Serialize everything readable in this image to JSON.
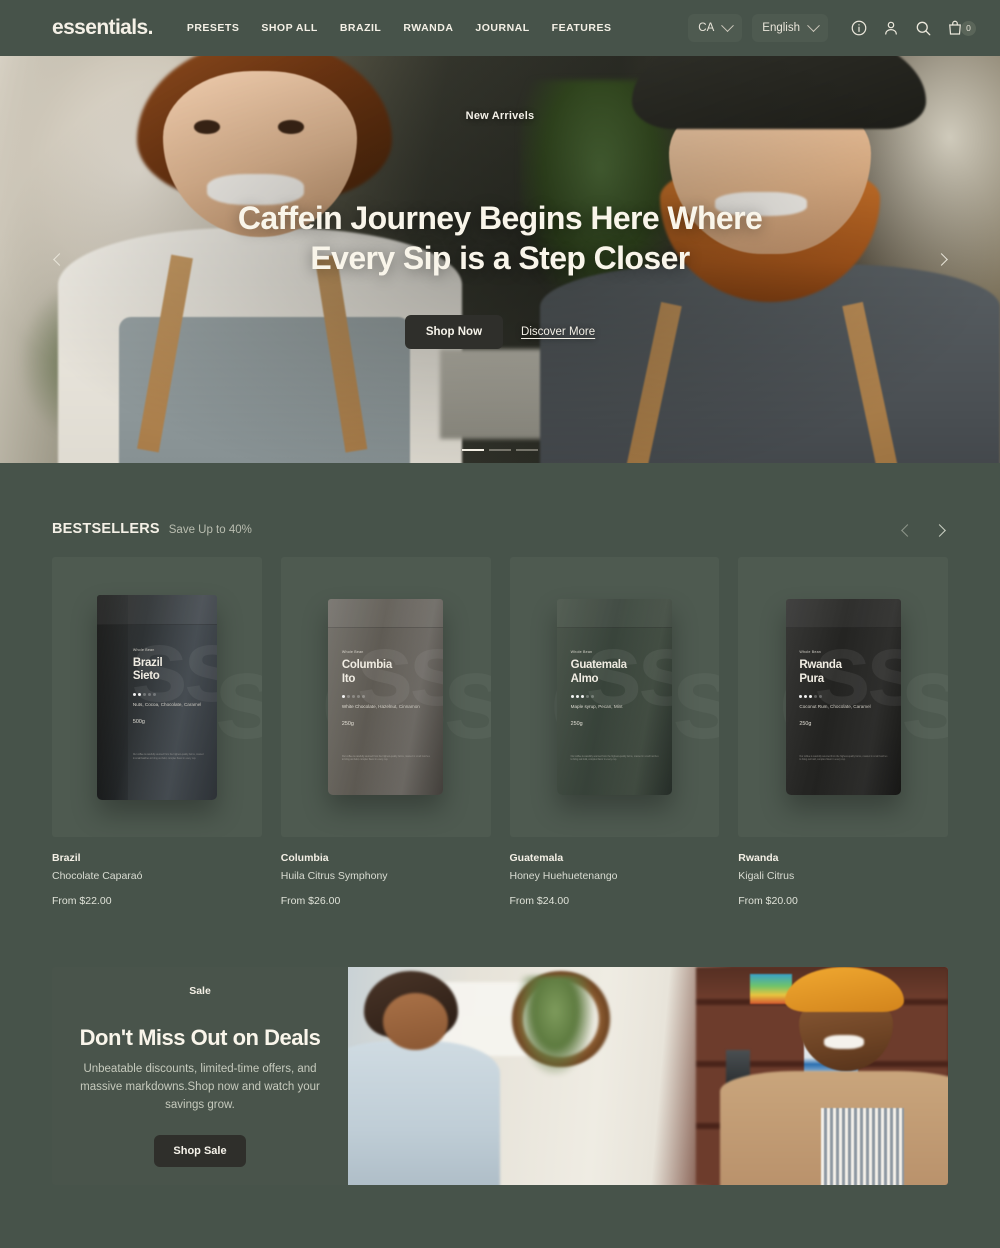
{
  "colors": {
    "page_bg": "#47534a",
    "card_bg": "#4e5a50",
    "cream": "#f4f0e6",
    "dark_button": "#2f2f2b"
  },
  "header": {
    "logo": "essentials.",
    "nav": [
      {
        "label": "PRESETS"
      },
      {
        "label": "SHOP ALL"
      },
      {
        "label": "BRAZIL"
      },
      {
        "label": "RWANDA"
      },
      {
        "label": "JOURNAL"
      },
      {
        "label": "FEATURES"
      }
    ],
    "country_selector": {
      "value": "CA",
      "icon": "chevron-down-icon"
    },
    "language_selector": {
      "value": "English",
      "icon": "chevron-down-icon"
    },
    "icons": [
      {
        "name": "info-icon"
      },
      {
        "name": "account-icon"
      },
      {
        "name": "search-icon"
      }
    ],
    "cart": {
      "name": "cart-icon",
      "count": "0"
    }
  },
  "hero": {
    "eyebrow": "New Arrivels",
    "title": "Caffein Journey Begins Here Where Every Sip is a Step Closer",
    "primary_cta": "Shop Now",
    "secondary_cta": "Discover More",
    "prev_icon": "chevron-left-icon",
    "next_icon": "chevron-right-icon",
    "slides_total": 3,
    "active_slide": 1
  },
  "bestsellers": {
    "title": "BESTSELLERS",
    "subtitle": "Save Up to 40%",
    "prev_icon": "chevron-left-icon",
    "next_icon": "chevron-right-icon",
    "products": [
      {
        "origin": "Brazil",
        "name": "Chocolate Caparaó",
        "price": "From $22.00",
        "bag": {
          "kicker": "Whole Bean",
          "line1": "Brazil",
          "line2": "Sieto",
          "roast_filled": 2,
          "notes": "Nuts, Cocoa, Chocolate, Caramel",
          "weight": "500g",
          "fine_print": "Our coffee is carefully sourced from the highest-quality farms, roasted in small batches to bring out bold, complex flavor in every cup."
        }
      },
      {
        "origin": "Columbia",
        "name": "Huila Citrus Symphony",
        "price": "From $26.00",
        "bag": {
          "kicker": "Whole Bean",
          "line1": "Columbia",
          "line2": "Ito",
          "roast_filled": 1,
          "notes": "White Chocolate, Hazelnut, Cinnamon",
          "weight": "250g",
          "fine_print": "Our coffee is carefully sourced from the highest-quality farms, roasted in small batches to bring out bold, complex flavor in every cup."
        }
      },
      {
        "origin": "Guatemala",
        "name": "Honey Huehuetenango",
        "price": "From $24.00",
        "bag": {
          "kicker": "Whole Bean",
          "line1": "Guatemala",
          "line2": "Almo",
          "roast_filled": 3,
          "notes": "Maple syrup, Pecan, Mint",
          "weight": "250g",
          "fine_print": "Our coffee is carefully sourced from the highest-quality farms, roasted in small batches to bring out bold, complex flavor in every cup."
        }
      },
      {
        "origin": "Rwanda",
        "name": "Kigali Citrus",
        "price": "From $20.00",
        "bag": {
          "kicker": "Whole Bean",
          "line1": "Rwanda",
          "line2": "Pura",
          "roast_filled": 3,
          "notes": "Coconut Rum, Chocolate, Caramel",
          "weight": "250g",
          "fine_print": "Our coffee is carefully sourced from the highest-quality farms, roasted in small batches to bring out bold, complex flavor in every cup."
        }
      }
    ]
  },
  "promo": {
    "eyebrow": "Sale",
    "title": "Don't Miss Out on Deals",
    "description": "Unbeatable discounts, limited-time offers, and massive markdowns.Shop now and watch your savings grow.",
    "cta": "Shop Sale"
  }
}
